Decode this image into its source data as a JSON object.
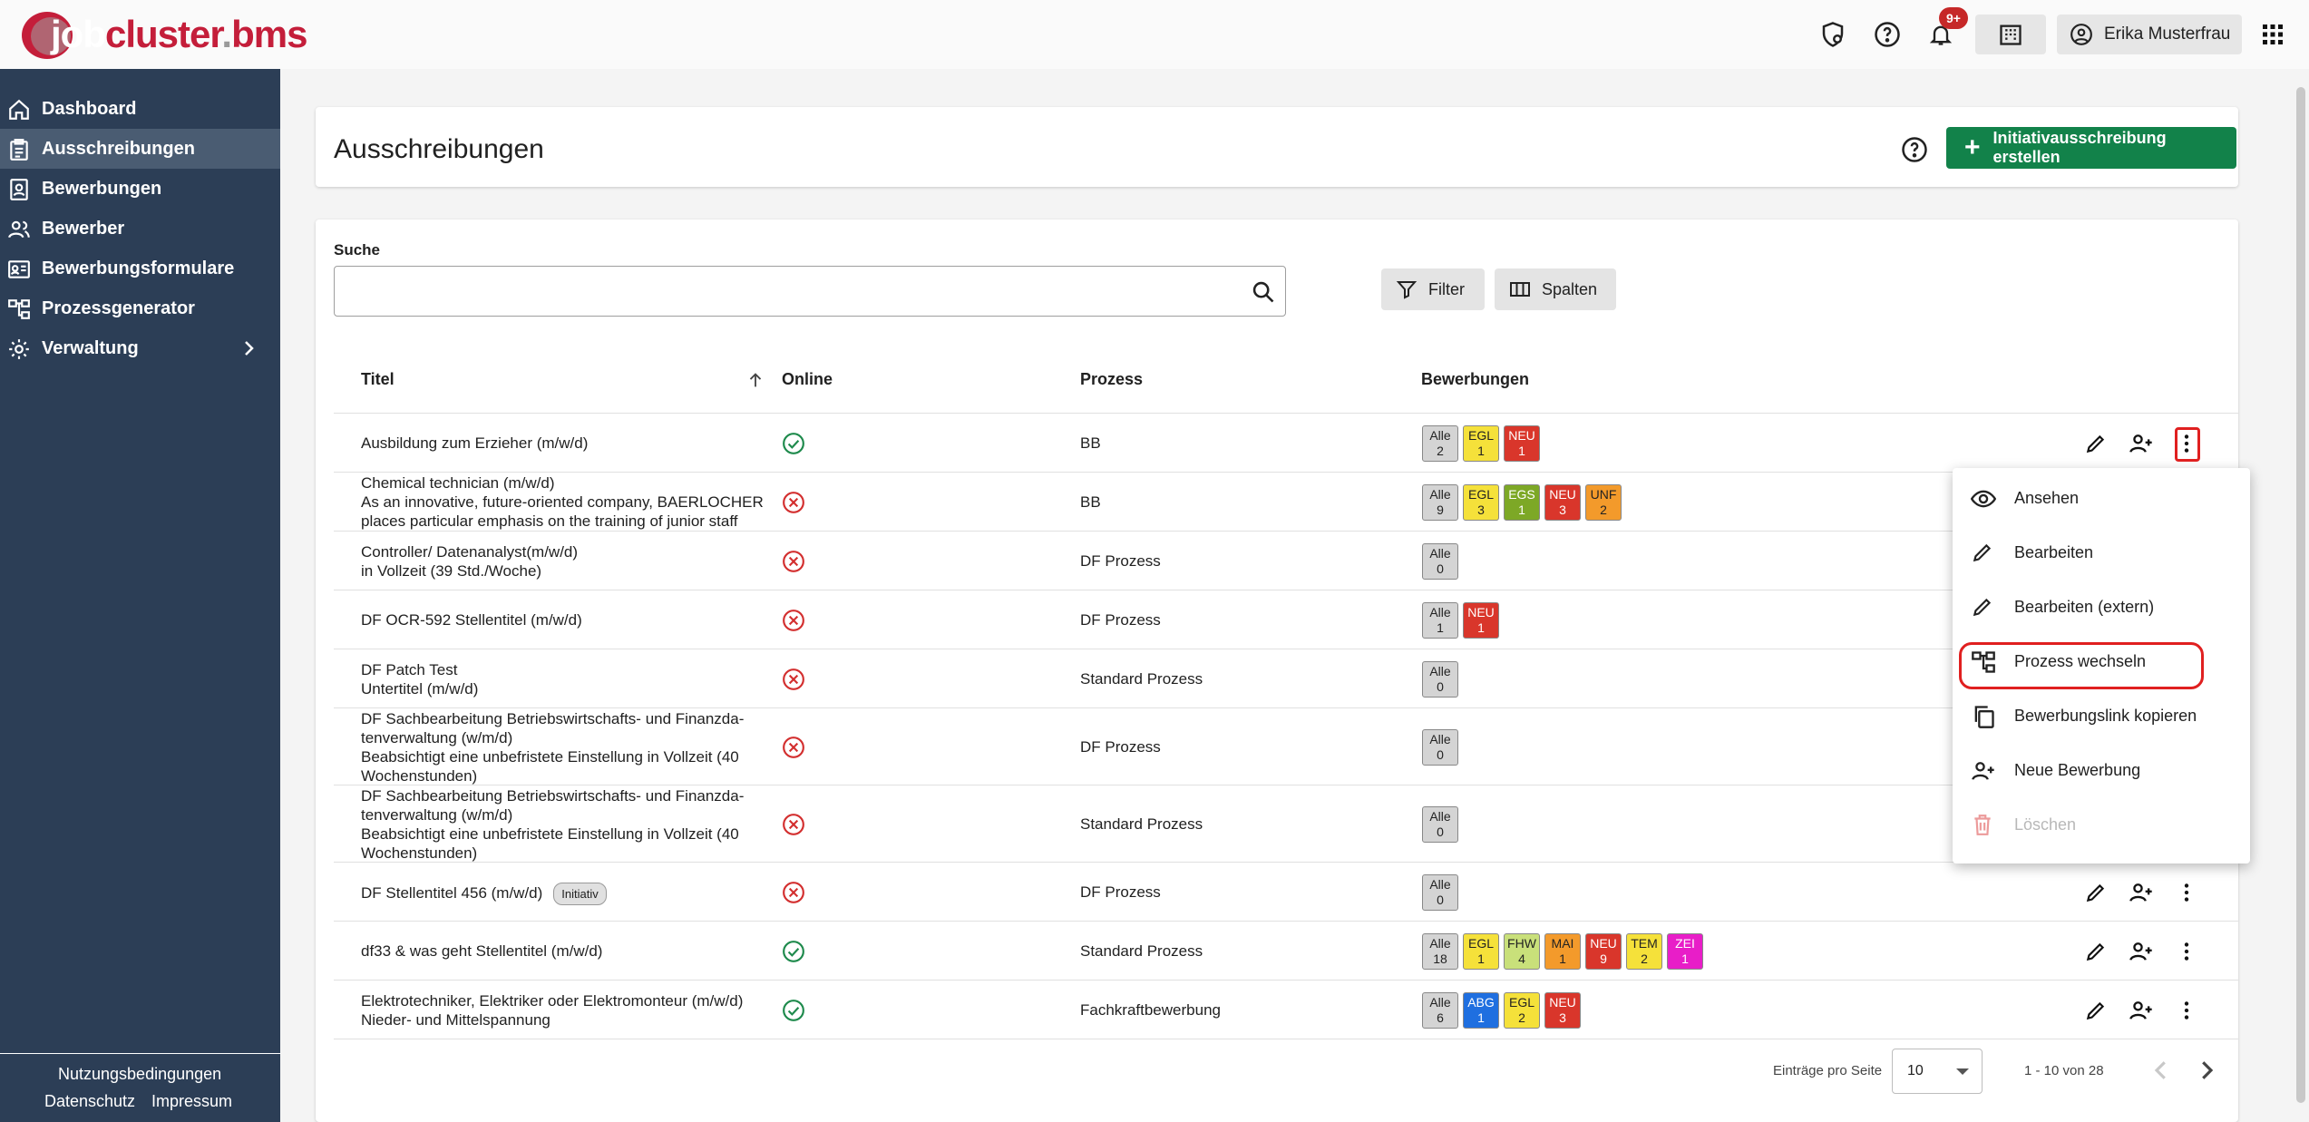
{
  "header": {
    "logo": {
      "job": "job",
      "cluster": "cluster",
      "dot": ".",
      "bms": "bms"
    },
    "notifications_badge": "9+",
    "user_name": "Erika Musterfrau"
  },
  "sidebar": {
    "items": [
      {
        "label": "Dashboard",
        "icon": "home-icon"
      },
      {
        "label": "Ausschreibungen",
        "icon": "clipboard-icon",
        "active": true
      },
      {
        "label": "Bewerbungen",
        "icon": "document-person-icon"
      },
      {
        "label": "Bewerber",
        "icon": "people-icon"
      },
      {
        "label": "Bewerbungsformulare",
        "icon": "id-card-icon"
      },
      {
        "label": "Prozessgenerator",
        "icon": "flow-icon"
      },
      {
        "label": "Verwaltung",
        "icon": "gear-icon",
        "has_children": true
      }
    ],
    "footer": {
      "terms": "Nutzungsbedingungen",
      "privacy": "Datenschutz",
      "imprint": "Impressum"
    }
  },
  "page": {
    "title": "Ausschreibungen",
    "create_button": "Initiativausschreibung erstellen",
    "search_label": "Suche",
    "search_value": "",
    "filter_button": "Filter",
    "columns_button": "Spalten"
  },
  "table": {
    "columns": {
      "title": "Titel",
      "online": "Online",
      "process": "Prozess",
      "applications": "Bewerbungen"
    },
    "rows": [
      {
        "title": [
          "Ausbildung zum Erzieher (m/w/d)"
        ],
        "online": true,
        "process": "BB",
        "tags": [
          [
            "Alle",
            "2"
          ],
          [
            "EGL",
            "1"
          ],
          [
            "NEU",
            "1"
          ]
        ]
      },
      {
        "title": [
          "Chemical technician (m/w/d)",
          "As an innovative, future-oriented company, BAERLOCHER",
          "places particular emphasis on the training of junior staff"
        ],
        "online": false,
        "process": "BB",
        "tags": [
          [
            "Alle",
            "9"
          ],
          [
            "EGL",
            "3"
          ],
          [
            "EGS",
            "1"
          ],
          [
            "NEU",
            "3"
          ],
          [
            "UNF",
            "2"
          ]
        ]
      },
      {
        "title": [
          "Controller/ Datenanalyst(m/w/d)",
          "in Vollzeit (39 Std./Woche)"
        ],
        "online": false,
        "process": "DF Prozess",
        "tags": [
          [
            "Alle",
            "0"
          ]
        ]
      },
      {
        "title": [
          "DF OCR-592 Stellentitel (m/w/d)"
        ],
        "online": false,
        "process": "DF Prozess",
        "tags": [
          [
            "Alle",
            "1"
          ],
          [
            "NEU",
            "1"
          ]
        ]
      },
      {
        "title": [
          "DF Patch Test",
          "Untertitel (m/w/d)"
        ],
        "online": false,
        "process": "Standard Prozess",
        "tags": [
          [
            "Alle",
            "0"
          ]
        ]
      },
      {
        "title": [
          "DF Sachbearbeitung Betriebswirtschafts- und Finanzda-",
          "tenverwaltung (w/m/d)",
          "Beabsichtigt eine unbefristete Einstellung in Vollzeit (40",
          "Wochenstunden)"
        ],
        "online": false,
        "process": "DF Prozess",
        "tags": [
          [
            "Alle",
            "0"
          ]
        ]
      },
      {
        "title": [
          "DF Sachbearbeitung Betriebswirtschafts- und Finanzda-",
          "tenverwaltung (w/m/d)",
          "Beabsichtigt eine unbefristete Einstellung in Vollzeit (40",
          "Wochenstunden)"
        ],
        "online": false,
        "process": "Standard Prozess",
        "tags": [
          [
            "Alle",
            "0"
          ]
        ]
      },
      {
        "title": [
          "DF Stellentitel 456 (m/w/d)"
        ],
        "badge": "Initiativ",
        "online": false,
        "process": "DF Prozess",
        "tags": [
          [
            "Alle",
            "0"
          ]
        ]
      },
      {
        "title": [
          "df33 & was geht Stellentitel (m/w/d)"
        ],
        "online": true,
        "process": "Standard Prozess",
        "tags": [
          [
            "Alle",
            "18"
          ],
          [
            "EGL",
            "1"
          ],
          [
            "FHW",
            "4"
          ],
          [
            "MAI",
            "1"
          ],
          [
            "NEU",
            "9"
          ],
          [
            "TEM",
            "2"
          ],
          [
            "ZEI",
            "1"
          ]
        ]
      },
      {
        "title": [
          "Elektrotechniker, Elektriker oder Elektromonteur (m/w/d)",
          "Nieder- und Mittelspannung"
        ],
        "online": true,
        "process": "Fachkraftbewerbung",
        "tags": [
          [
            "Alle",
            "6"
          ],
          [
            "ABG",
            "1"
          ],
          [
            "EGL",
            "2"
          ],
          [
            "NEU",
            "3"
          ]
        ]
      }
    ]
  },
  "tag_colors": {
    "Alle": "#d4d4d4",
    "EGL": "#f5e13a",
    "EGS": "#7da826",
    "NEU": "#d9362b",
    "UNF": "#f39a2b",
    "FHW": "#c9e07a",
    "MAI": "#f39a2b",
    "TEM": "#f5e13a",
    "ZEI": "#e81ec8",
    "ABG": "#1f6fe0"
  },
  "pagination": {
    "label": "Einträge pro Seite",
    "page_size": "10",
    "range": "1 - 10 von 28"
  },
  "context_menu": {
    "items": [
      {
        "label": "Ansehen",
        "icon": "eye-icon",
        "disabled": false
      },
      {
        "label": "Bearbeiten",
        "icon": "pencil-icon",
        "disabled": false
      },
      {
        "label": "Bearbeiten (extern)",
        "icon": "pencil-icon",
        "disabled": false
      },
      {
        "label": "Prozess wechseln",
        "icon": "flow-icon",
        "disabled": false
      },
      {
        "label": "Bewerbungslink kopieren",
        "icon": "copy-icon",
        "disabled": false
      },
      {
        "label": "Neue Bewerbung",
        "icon": "person-add-icon",
        "disabled": false
      },
      {
        "label": "Löschen",
        "icon": "trash-icon",
        "disabled": true
      }
    ]
  }
}
